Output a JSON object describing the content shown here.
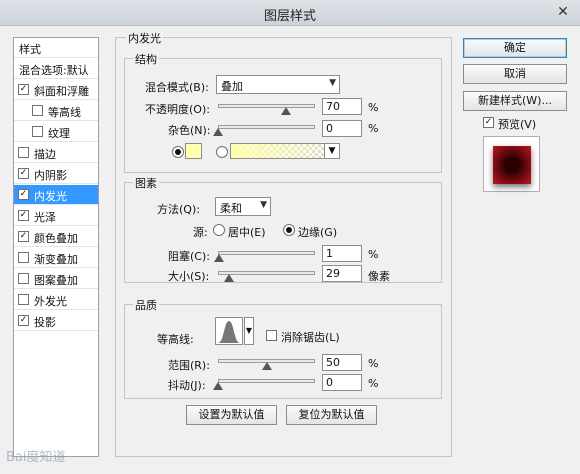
{
  "window": {
    "title": "图层样式",
    "close_symbol": "✕"
  },
  "style_list": {
    "header": "样式",
    "items": [
      {
        "label": "混合选项:默认",
        "checkbox": false,
        "checked": false,
        "selected": false,
        "indent": false
      },
      {
        "label": "斜面和浮雕",
        "checkbox": true,
        "checked": true,
        "selected": false,
        "indent": false
      },
      {
        "label": "等高线",
        "checkbox": true,
        "checked": false,
        "selected": false,
        "indent": true
      },
      {
        "label": "纹理",
        "checkbox": true,
        "checked": false,
        "selected": false,
        "indent": true
      },
      {
        "label": "描边",
        "checkbox": true,
        "checked": false,
        "selected": false,
        "indent": false
      },
      {
        "label": "内阴影",
        "checkbox": true,
        "checked": true,
        "selected": false,
        "indent": false
      },
      {
        "label": "内发光",
        "checkbox": true,
        "checked": true,
        "selected": true,
        "indent": false
      },
      {
        "label": "光泽",
        "checkbox": true,
        "checked": true,
        "selected": false,
        "indent": false
      },
      {
        "label": "颜色叠加",
        "checkbox": true,
        "checked": true,
        "selected": false,
        "indent": false
      },
      {
        "label": "渐变叠加",
        "checkbox": true,
        "checked": false,
        "selected": false,
        "indent": false
      },
      {
        "label": "图案叠加",
        "checkbox": true,
        "checked": false,
        "selected": false,
        "indent": false
      },
      {
        "label": "外发光",
        "checkbox": true,
        "checked": false,
        "selected": false,
        "indent": false
      },
      {
        "label": "投影",
        "checkbox": true,
        "checked": true,
        "selected": false,
        "indent": false
      }
    ]
  },
  "panel": {
    "title": "内发光",
    "structure": {
      "title": "结构",
      "blend_mode_label": "混合模式(B):",
      "blend_mode_value": "叠加",
      "opacity_label": "不透明度(O):",
      "opacity_value": "70",
      "opacity_level": 0.7,
      "noise_label": "杂色(N):",
      "noise_value": "0",
      "noise_level": 0.0,
      "percent": "%",
      "solid_color": "#ffffb0",
      "gradient_color": "#ffffb0"
    },
    "elements": {
      "title": "图素",
      "technique_label": "方法(Q):",
      "technique_value": "柔和",
      "source_label": "源:",
      "source_center": "居中(E)",
      "source_edge": "边缘(G)",
      "choke_label": "阻塞(C):",
      "choke_value": "1",
      "choke_level": 0.01,
      "size_label": "大小(S):",
      "size_value": "29",
      "size_level": 0.116,
      "size_unit": "像素",
      "percent": "%"
    },
    "quality": {
      "title": "品质",
      "contour_label": "等高线:",
      "antialias_label": "消除锯齿(L)",
      "range_label": "范围(R):",
      "range_value": "50",
      "range_level": 0.5,
      "jitter_label": "抖动(J):",
      "jitter_value": "0",
      "jitter_level": 0.0,
      "percent": "%"
    },
    "make_default": "设置为默认值",
    "reset_default": "复位为默认值"
  },
  "buttons": {
    "ok": "确定",
    "cancel": "取消",
    "new_style": "新建样式(W)...",
    "preview_label": "预览(V)"
  },
  "watermark": "Bai度知道"
}
